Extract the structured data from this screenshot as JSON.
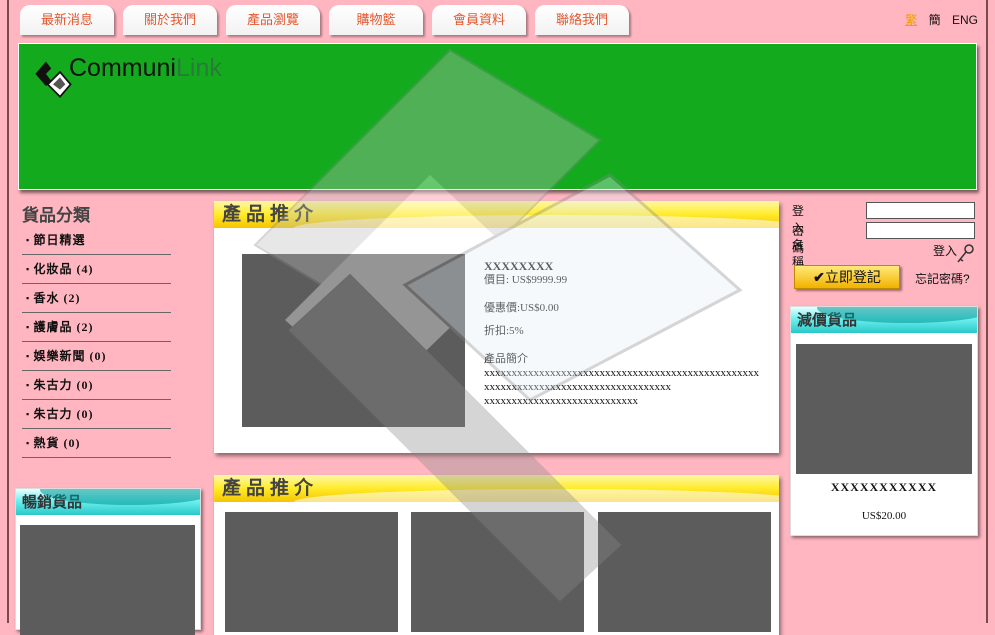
{
  "nav": {
    "tabs": [
      "最新消息",
      "關於我們",
      "產品瀏覽",
      "購物籃",
      "會員資料",
      "聯絡我們"
    ]
  },
  "lang": {
    "items": [
      "繁",
      "簡",
      "ENG"
    ],
    "active": "繁"
  },
  "banner": {
    "logo_text_dark": "Communi",
    "logo_text_light": "Link",
    "bg_color": "#14aa1e"
  },
  "categories": {
    "title": "貨品分類",
    "items": [
      "節日精選",
      "化妝品 (4)",
      "香水 (2)",
      "護膚品 (2)",
      "娛樂新聞 (0)",
      "朱古力 (0)",
      "朱古力 (0)",
      "熱貨 (0)"
    ]
  },
  "bestsellers": {
    "title": "暢銷貨品"
  },
  "featured": {
    "title": "產品推介",
    "name": "XXXXXXXX",
    "price_label": "價目: US$9999.99",
    "discount_price": "優惠價:US$0.00",
    "discount_pct": "折扣:5%",
    "desc_label": "產品簡介",
    "desc_lines": [
      "xxxxxxxxxxxxxxxxxxxxxxxxxxxxxxxxxxxxxxxxxxxxxxxxxx",
      "xxxxxxxxxxxxxxxxxxxxxxxxxxxxxxxxxx",
      "xxxxxxxxxxxxxxxxxxxxxxxxxxxx"
    ]
  },
  "recommend2": {
    "title": "產品推介"
  },
  "login": {
    "username_label": "登入名稱",
    "password_label": "密碼",
    "login_label": "登入",
    "register_label": "立即登記",
    "forgot_label": "忘記密碼?"
  },
  "sale": {
    "title": "減價貨品",
    "name": "XXXXXXXXXXX",
    "price": "US$20.00"
  },
  "colors": {
    "page_bg": "#ffb6c1",
    "banner": "#14aa1e",
    "nav_text": "#e4572e"
  }
}
